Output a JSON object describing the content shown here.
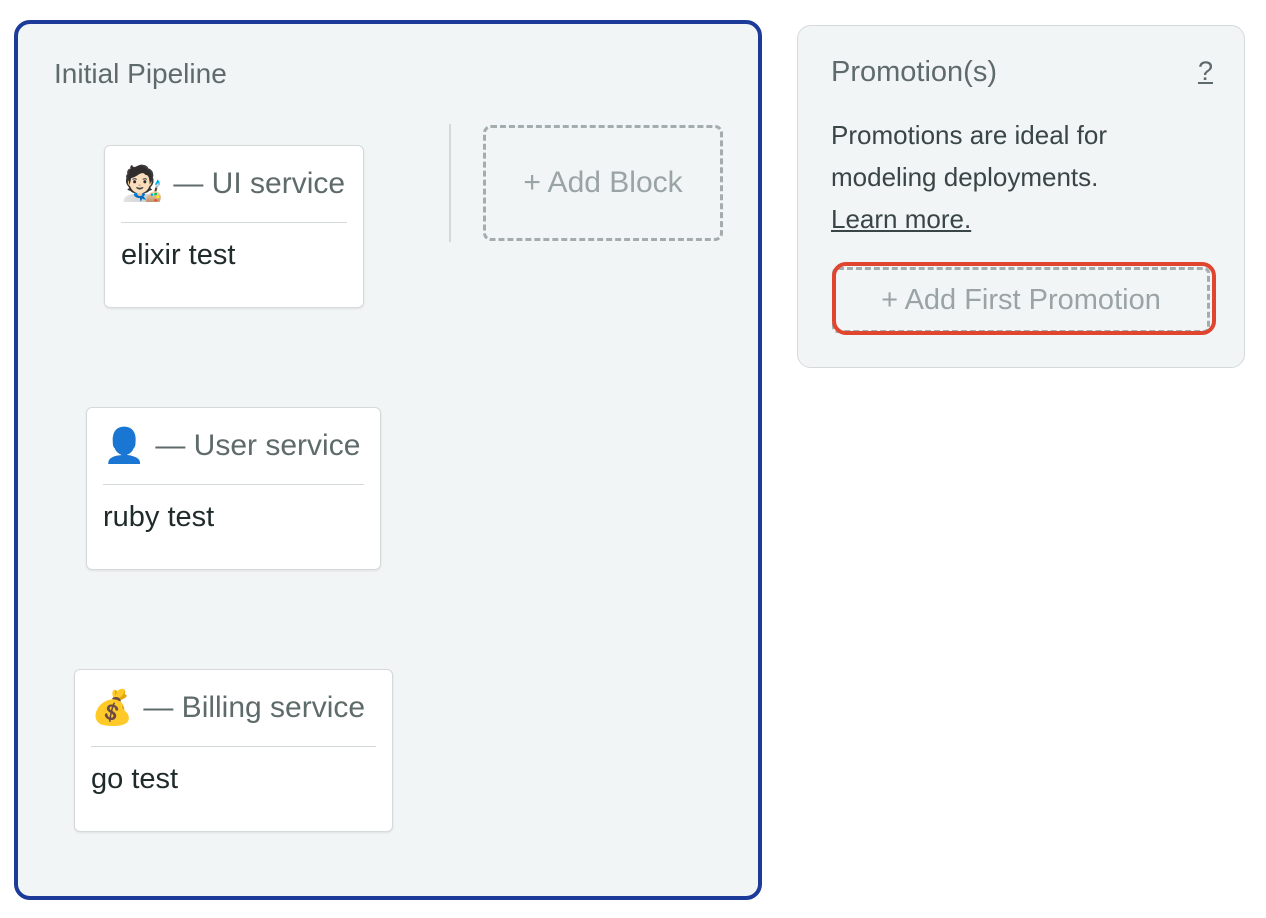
{
  "pipeline": {
    "title": "Initial Pipeline",
    "blocks": [
      {
        "emoji": "🧑🏻‍🎨",
        "name": "— UI service",
        "job": "elixir test",
        "icon": "artist-emoji-icon"
      },
      {
        "emoji": "👤",
        "name": "— User service",
        "job": "ruby test",
        "icon": "user-silhouette-emoji-icon"
      },
      {
        "emoji": "💰",
        "name": "— Billing service",
        "job": "go test",
        "icon": "money-bag-emoji-icon"
      }
    ],
    "add_block_label": "+ Add Block"
  },
  "promotions": {
    "title": "Promotion(s)",
    "help_label": "?",
    "description": "Promotions are ideal for modeling deployments.",
    "learn_more_label": "Learn more.",
    "add_first_label": "+ Add First Promotion"
  },
  "colors": {
    "pipeline_border": "#1b3a9a",
    "panel_bg": "#f2f5f5",
    "highlight": "#e0452f",
    "muted_text": "#5f6b6b"
  }
}
